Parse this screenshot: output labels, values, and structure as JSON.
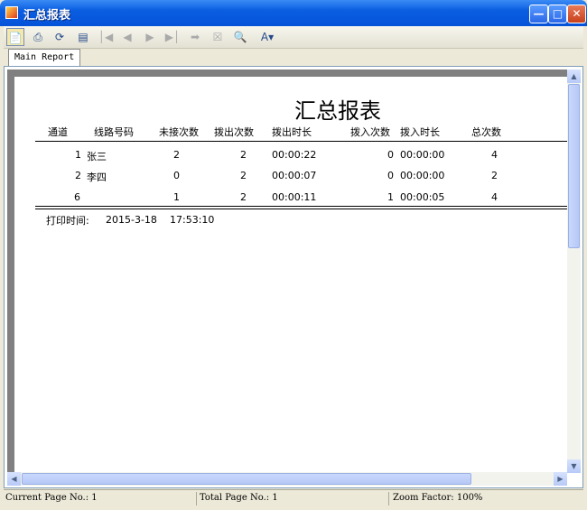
{
  "window": {
    "title": "汇总报表"
  },
  "tabs": {
    "main": "Main Report"
  },
  "report": {
    "title": "汇总报表",
    "headers": [
      "通道",
      "线路号码",
      "未接次数",
      "拨出次数",
      "拨出时长",
      "拨入次数",
      "拨入时长",
      "总次数"
    ],
    "rows": [
      [
        "1",
        "张三",
        "2",
        "2",
        "00:00:22",
        "0",
        "00:00:00",
        "4"
      ],
      [
        "2",
        "李四",
        "0",
        "2",
        "00:00:07",
        "0",
        "00:00:00",
        "2"
      ]
    ],
    "total": [
      "6",
      "",
      "1",
      "2",
      "00:00:11",
      "1",
      "00:00:05",
      "4"
    ],
    "print_label": "打印时间:",
    "print_date": "2015-3-18",
    "print_time": "17:53:10"
  },
  "status": {
    "current_page": "Current Page No.: 1",
    "total_page": "Total Page No.: 1",
    "zoom": "Zoom Factor: 100%"
  }
}
